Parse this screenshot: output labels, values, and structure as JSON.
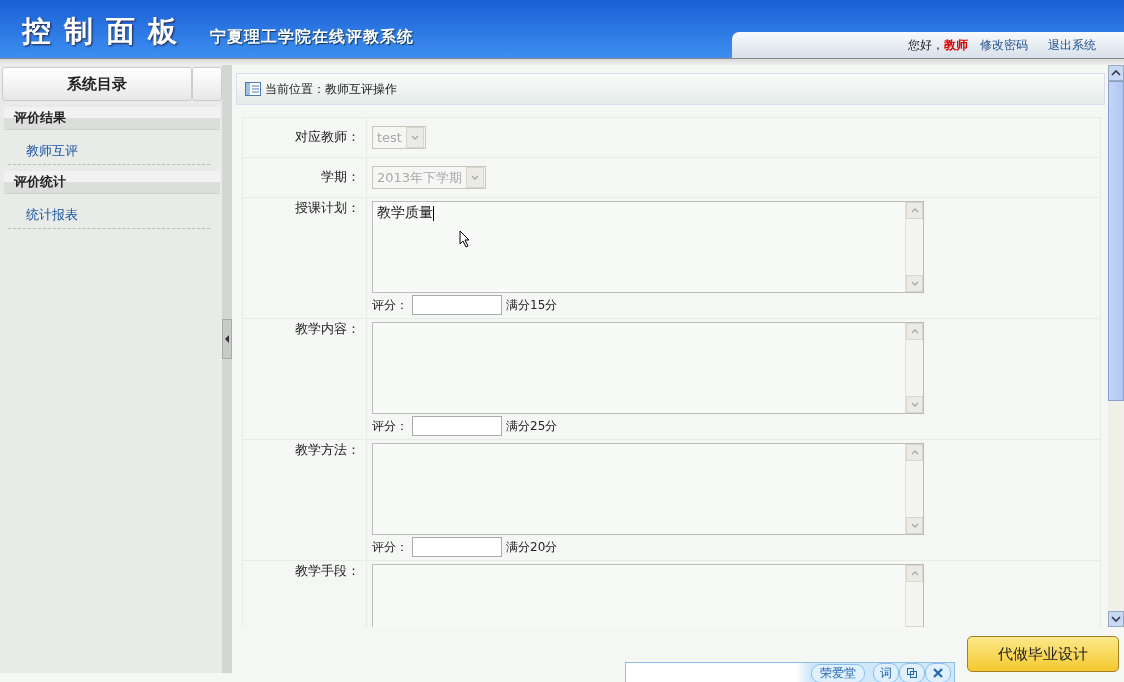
{
  "header": {
    "title": "控制面板",
    "subtitle": "宁夏理工学院在线评教系统",
    "greeting": "您好，",
    "user": "教师",
    "links": [
      "修改密码",
      "退出系统"
    ]
  },
  "sidebar": {
    "title": "系统目录",
    "groups": [
      {
        "heading": "评价结果",
        "items": [
          "教师互评"
        ]
      },
      {
        "heading": "评价统计",
        "items": [
          "统计报表"
        ]
      }
    ]
  },
  "breadcrumb": "当前位置：教师互评操作",
  "form": {
    "fields": [
      {
        "kind": "select",
        "label": "对应教师：",
        "value": "test",
        "disabled": true
      },
      {
        "kind": "select",
        "label": "学期：",
        "value": "2013年下学期",
        "disabled": true
      },
      {
        "kind": "textarea",
        "label": "授课计划：",
        "value": "教学质量",
        "score_label": "评分：",
        "max": "满分15分"
      },
      {
        "kind": "textarea",
        "label": "教学内容：",
        "score_label": "评分：",
        "max": "满分25分"
      },
      {
        "kind": "textarea",
        "label": "教学方法：",
        "score_label": "评分：",
        "max": "满分20分"
      },
      {
        "kind": "textarea",
        "label": "教学手段："
      }
    ]
  },
  "ime_bar": {
    "name": "荣爱堂",
    "button": "词"
  },
  "ad": "代做毕业设计"
}
